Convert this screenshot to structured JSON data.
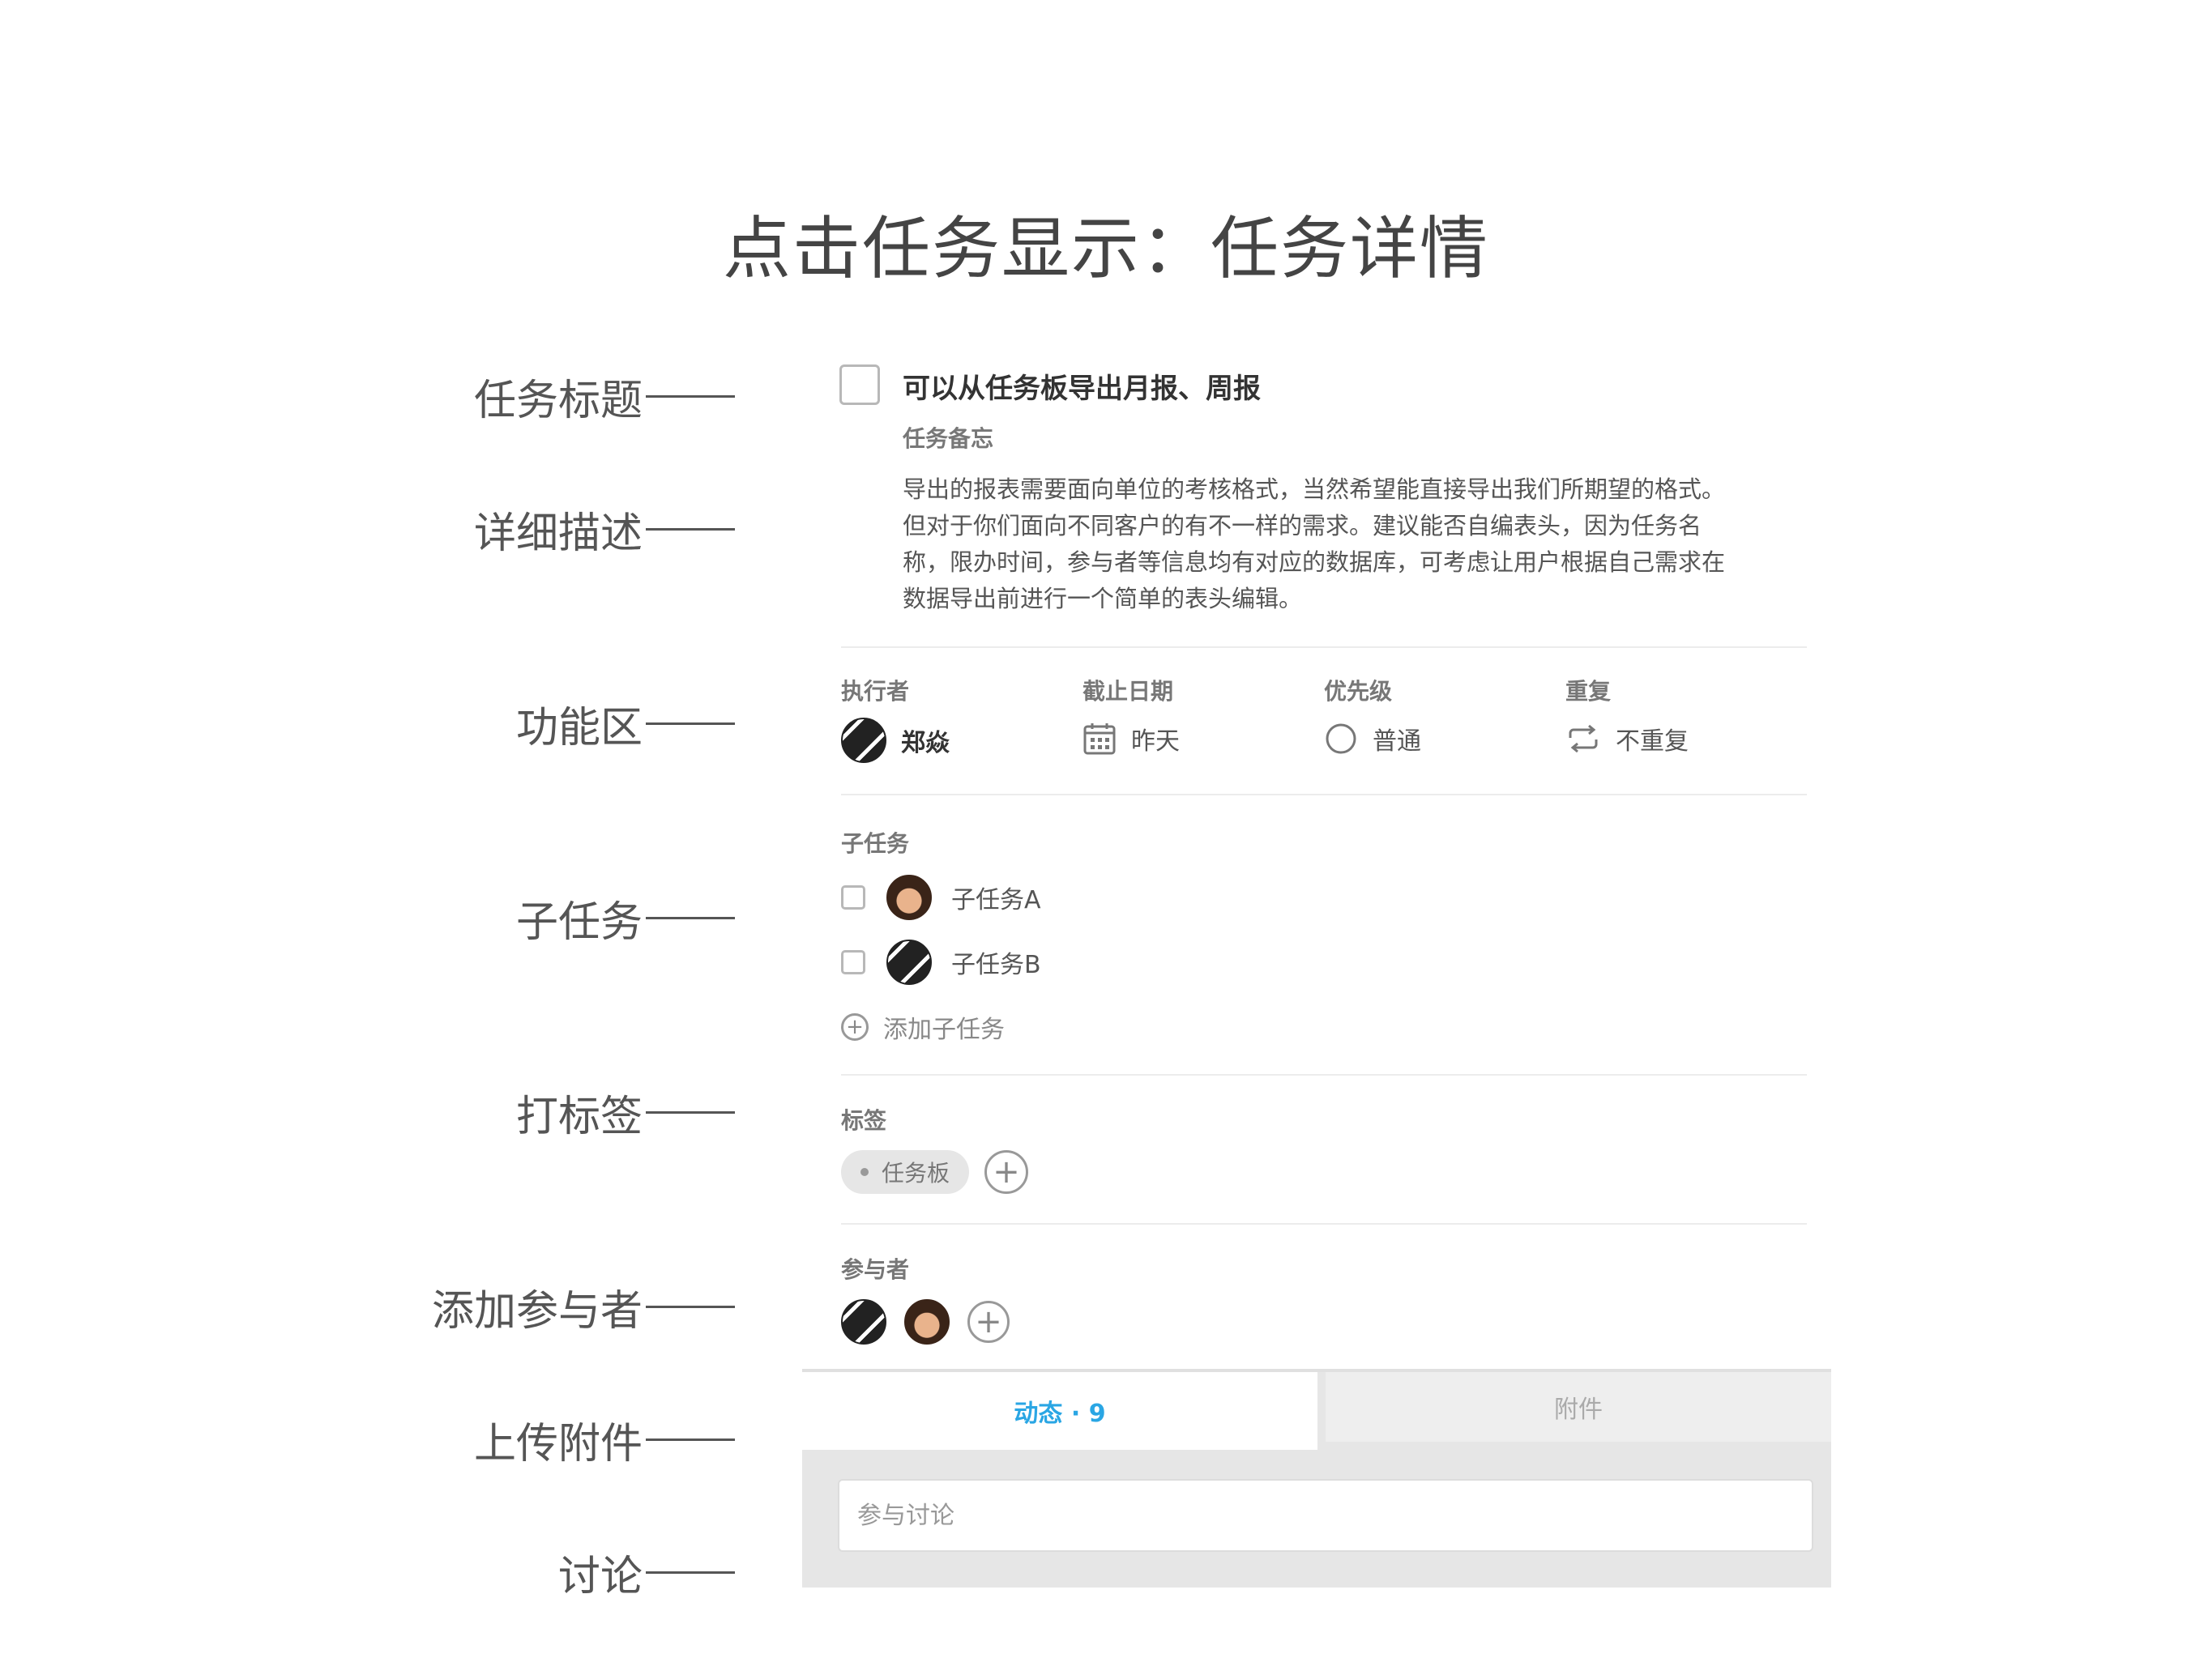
{
  "page_title": "点击任务显示：任务详情",
  "annotations": [
    "任务标题",
    "详细描述",
    "功能区",
    "子任务",
    "打标签",
    "添加参与者",
    "上传附件",
    "讨论"
  ],
  "task": {
    "title": "可以从任务板导出月报、周报",
    "memo_label": "任务备忘",
    "memo_lines": [
      "导出的报表需要面向单位的考核格式，当然希望能直接导出我们所期望的格式。",
      "但对于你们面向不同客户的有不一样的需求。建议能否自编表头，因为任务名",
      "称，限办时间，参与者等信息均有对应的数据库，可考虑让用户根据自己需求在",
      "数据导出前进行一个简单的表头编辑。"
    ]
  },
  "fields": {
    "executor": {
      "label": "执行者",
      "value": "郑焱"
    },
    "due_date": {
      "label": "截止日期",
      "value": "昨天"
    },
    "priority": {
      "label": "优先级",
      "value": "普通"
    },
    "repeat": {
      "label": "重复",
      "value": "不重复"
    }
  },
  "subtasks": {
    "label": "子任务",
    "items": [
      "子任务A",
      "子任务B"
    ],
    "add_label": "添加子任务"
  },
  "tags": {
    "label": "标签",
    "items": [
      "任务板"
    ]
  },
  "participants": {
    "label": "参与者"
  },
  "tabs": {
    "activity": "动态 · 9",
    "attachments": "附件"
  },
  "comment": {
    "placeholder": "参与讨论"
  },
  "colors": {
    "accent": "#2aa6e4",
    "divider": "#ececec",
    "panel_bg": "#e6e6e6"
  }
}
